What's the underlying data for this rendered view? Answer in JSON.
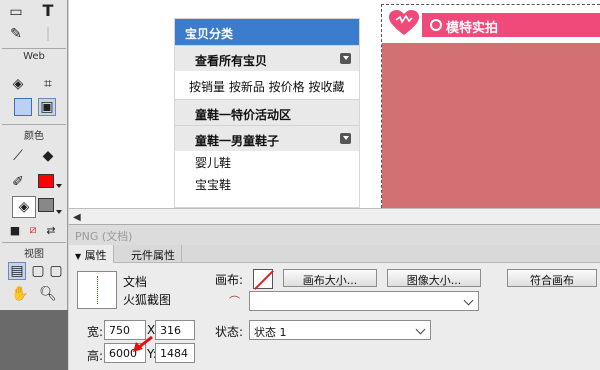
{
  "tools": {
    "web_label": "Web",
    "color_label": "颜色",
    "view_label": "视图",
    "stroke_color": "#000000",
    "fill_color": "#ff0000",
    "swatch_gray": "#888888"
  },
  "document": {
    "category": {
      "header": "宝贝分类",
      "view_all": "查看所有宝贝",
      "links": "按销量 按新品 按价格 按收藏",
      "group1": "童鞋一特价活动区",
      "group2": "童鞋一男童鞋子",
      "sub_items": [
        "婴儿鞋",
        "宝宝鞋"
      ]
    },
    "banner": {
      "title": "模特实拍"
    }
  },
  "properties": {
    "panel_title": "PNG (文档)",
    "tabs": [
      "属性",
      "元件属性"
    ],
    "doc_type": "文档",
    "doc_name": "火狐截图",
    "canvas_label": "画布:",
    "canvas_size_btn": "画布大小...",
    "image_size_btn": "图像大小...",
    "fit_canvas_btn": "符合画布",
    "width_label": "宽:",
    "width_value": "750",
    "x_label": "X:",
    "x_value": "316",
    "height_label": "高:",
    "height_value": "6000",
    "y_label": "Y:",
    "y_value": "1484",
    "state_label": "状态:",
    "state_value": "状态 1"
  }
}
